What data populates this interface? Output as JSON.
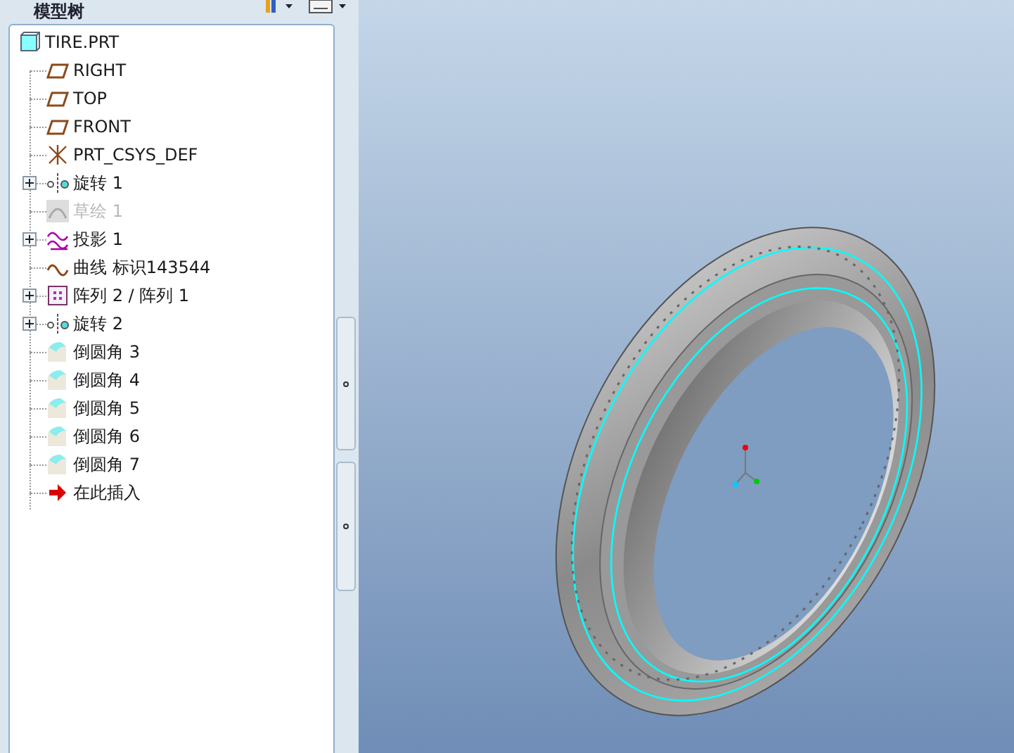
{
  "panel": {
    "title": "模型树"
  },
  "tree": {
    "label": "TIRE.PRT",
    "kind": "part",
    "children": [
      {
        "label": "RIGHT",
        "kind": "plane"
      },
      {
        "label": "TOP",
        "kind": "plane"
      },
      {
        "label": "FRONT",
        "kind": "plane"
      },
      {
        "label": "PRT_CSYS_DEF",
        "kind": "csys"
      },
      {
        "label": "旋转 1",
        "kind": "revolve",
        "expanded": false,
        "disabled": false
      },
      {
        "label": "草绘 1",
        "kind": "sketch",
        "disabled": true
      },
      {
        "label": "投影 1",
        "kind": "project",
        "expanded": false,
        "disabled": false
      },
      {
        "label": "曲线 标识143544",
        "kind": "curve"
      },
      {
        "label": "阵列 2 / 阵列 1",
        "kind": "pattern",
        "expanded": false,
        "disabled": false
      },
      {
        "label": "旋转 2",
        "kind": "revolve",
        "expanded": false,
        "disabled": false
      },
      {
        "label": "倒圆角 3",
        "kind": "round"
      },
      {
        "label": "倒圆角 4",
        "kind": "round"
      },
      {
        "label": "倒圆角 5",
        "kind": "round"
      },
      {
        "label": "倒圆角 6",
        "kind": "round"
      },
      {
        "label": "倒圆角 7",
        "kind": "round"
      },
      {
        "label": "在此插入",
        "kind": "insert"
      }
    ]
  }
}
